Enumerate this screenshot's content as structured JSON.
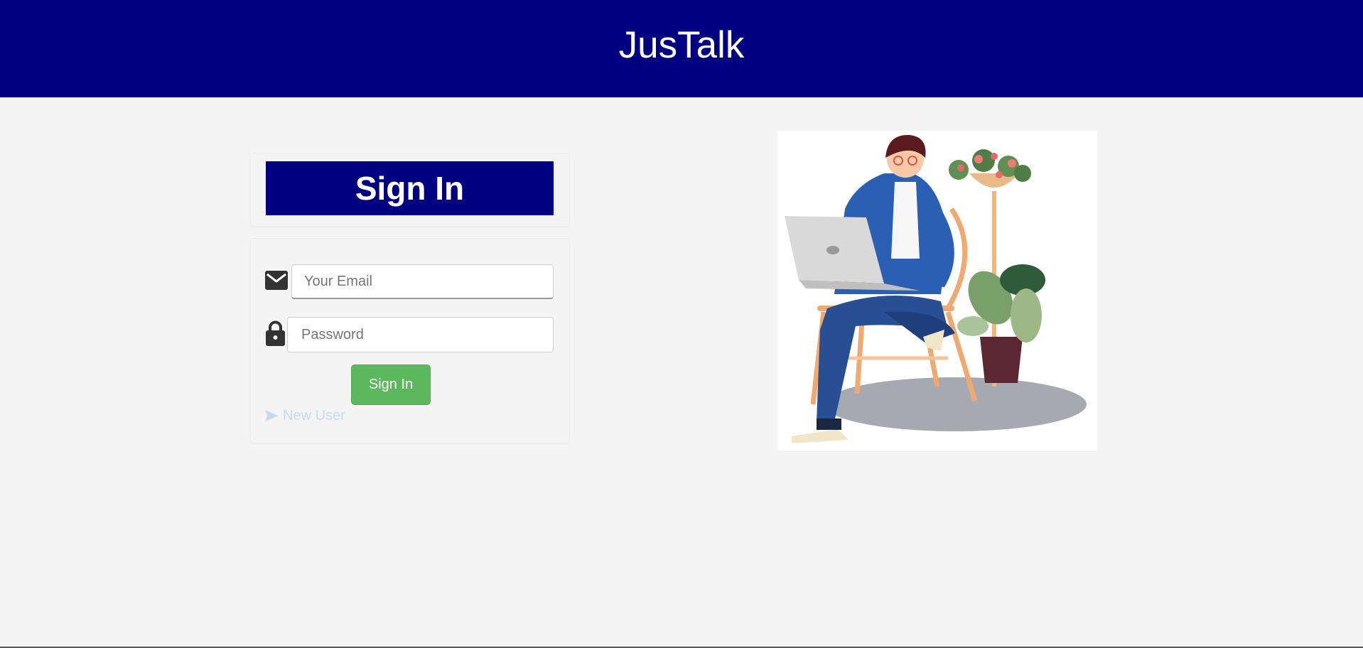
{
  "header": {
    "app_title": "JusTalk"
  },
  "signin_card": {
    "heading": "Sign In",
    "email": {
      "placeholder": "Your Email",
      "value": ""
    },
    "password": {
      "placeholder": "Password",
      "value": ""
    },
    "submit_label": "Sign In",
    "new_user_label": "New User"
  },
  "icons": {
    "email": "envelope-icon",
    "password": "lock-icon",
    "new_user": "send-arrow-icon"
  },
  "colors": {
    "brand_navy": "#000080",
    "page_bg": "#f4f4f4",
    "success_green": "#5cb85c",
    "link_light": "#c9d9ec"
  }
}
